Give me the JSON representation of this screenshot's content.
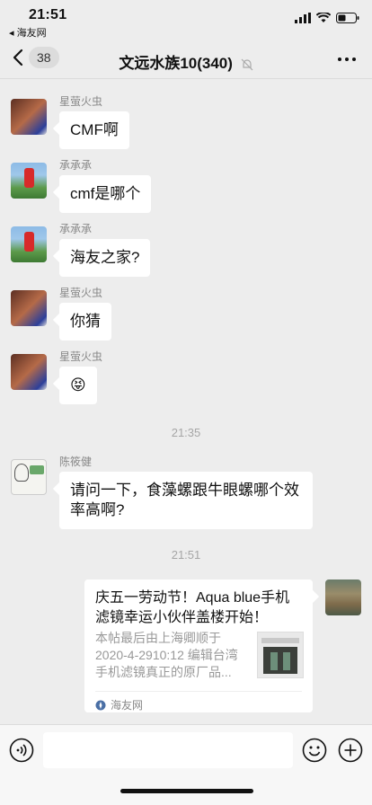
{
  "status_bar": {
    "time": "21:51",
    "back_app": "◂ 海友网"
  },
  "nav": {
    "back_count": "38",
    "title": "文远水族10(340)"
  },
  "messages": [
    {
      "sender": "星萤火虫",
      "text": "CMF啊"
    },
    {
      "sender": "承承承",
      "text": "cmf是哪个"
    },
    {
      "sender": "承承承",
      "text": "海友之家?"
    },
    {
      "sender": "星萤火虫",
      "text": "你猜"
    },
    {
      "sender": "星萤火虫",
      "text": "😝"
    },
    {
      "sender": "陈筱健",
      "text": "请问一下，食藻螺跟牛眼螺哪个效率高啊?"
    }
  ],
  "time_dividers": [
    "21:35",
    "21:51"
  ],
  "link_card": {
    "title": "庆五一劳动节！Aqua blue手机滤镜幸运小伙伴盖楼开始！",
    "description": "本帖最后由上海卿顺于 2020-4-2910:12 编辑台湾手机滤镜真正的原厂品...",
    "source": "海友网"
  },
  "input": {
    "placeholder": ""
  },
  "icons": {
    "back": "chevron-left-icon",
    "mute": "mute-bell-icon",
    "more": "more-dots-icon",
    "voice": "voice-icon",
    "emoji": "emoji-icon",
    "plus": "plus-icon"
  }
}
